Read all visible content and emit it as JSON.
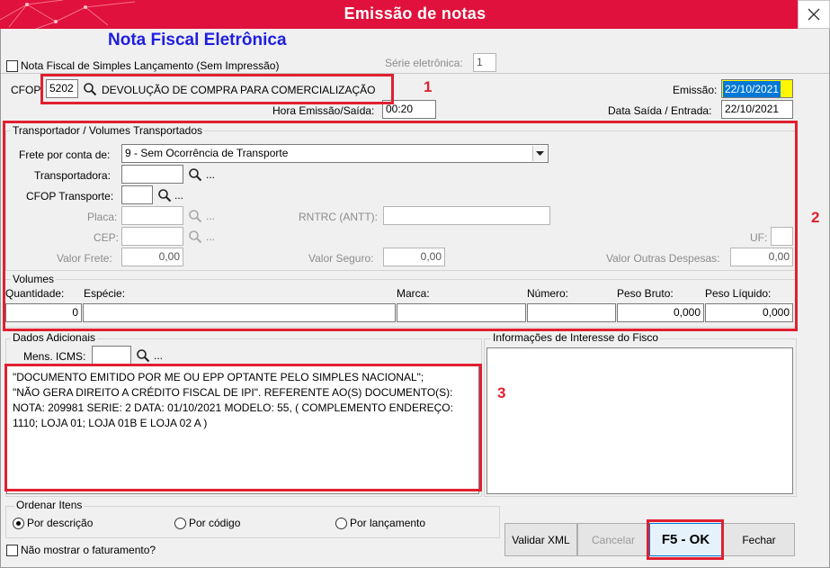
{
  "window": {
    "title": "Emissão de notas"
  },
  "header": {
    "nfe_title": "Nota Fiscal Eletrônica",
    "simples_checkbox_label": "Nota Fiscal de Simples Lançamento (Sem Impressão)",
    "serie_label": "Série eletrônica:",
    "serie_value": "1",
    "cfop_label": "CFOP",
    "cfop_value": "5202",
    "cfop_desc": "DEVOLUÇÃO DE COMPRA PARA COMERCIALIZAÇÃO",
    "emissao_label": "Emissão:",
    "emissao_value": "22/10/2021",
    "hora_label": "Hora Emissão/Saída:",
    "hora_value": "00:20",
    "data_saida_label": "Data Saída / Entrada:",
    "data_saida_value": "22/10/2021"
  },
  "transport": {
    "group_title": "Transportador /  Volumes Transportados",
    "frete_label": "Frete por conta de:",
    "frete_value": "9 - Sem Ocorrência de Transporte",
    "transportadora_label": "Transportadora:",
    "cfop_transporte_label": "CFOP Transporte:",
    "placa_label": "Placa:",
    "rntrc_label": "RNTRC (ANTT):",
    "cep_label": "CEP:",
    "uf_label": "UF:",
    "valor_frete_label": "Valor Frete:",
    "valor_frete_value": "0,00",
    "valor_seguro_label": "Valor Seguro:",
    "valor_seguro_value": "0,00",
    "valor_outras_label": "Valor Outras Despesas:",
    "valor_outras_value": "0,00",
    "dots": "..."
  },
  "volumes": {
    "group_title": "Volumes",
    "quantidade_label": "Quantidade:",
    "quantidade_value": "0",
    "especie_label": "Espécie:",
    "marca_label": "Marca:",
    "numero_label": "Número:",
    "peso_bruto_label": "Peso Bruto:",
    "peso_bruto_value": "0,000",
    "peso_liquido_label": "Peso Líquido:",
    "peso_liquido_value": "0,000"
  },
  "adicionais": {
    "group_title": "Dados Adicionais",
    "mens_icms_label": "Mens. ICMS:",
    "text": "\"DOCUMENTO EMITIDO POR ME OU EPP OPTANTE PELO SIMPLES NACIONAL\";\n\"NÃO GERA DIREITO A CRÉDITO FISCAL DE IPI\". REFERENTE AO(S) DOCUMENTO(S):\nNOTA: 209981 SERIE: 2 DATA: 01/10/2021 MODELO: 55, ( COMPLEMENTO ENDEREÇO:\n1110; LOJA 01; LOJA 01B E LOJA 02 A )",
    "fisco_title": "Informações de Interesse do Fisco"
  },
  "ordenar": {
    "group_title": "Ordenar Itens",
    "opt_descricao": "Por descrição",
    "opt_codigo": "Por código",
    "opt_lancamento": "Por lançamento",
    "selected": "descricao"
  },
  "footer": {
    "nao_mostrar_label": "Não mostrar o faturamento?",
    "validar_xml": "Validar XML",
    "cancelar": "Cancelar",
    "ok": "F5 - OK",
    "fechar": "Fechar"
  },
  "annotations": {
    "n1": "1",
    "n2": "2",
    "n3": "3"
  },
  "colors": {
    "titlebar": "#e0113c",
    "nfe_title": "#1e1ee0",
    "annotation": "#e02030",
    "highlight": "#fff700",
    "selection": "#0078d7"
  }
}
